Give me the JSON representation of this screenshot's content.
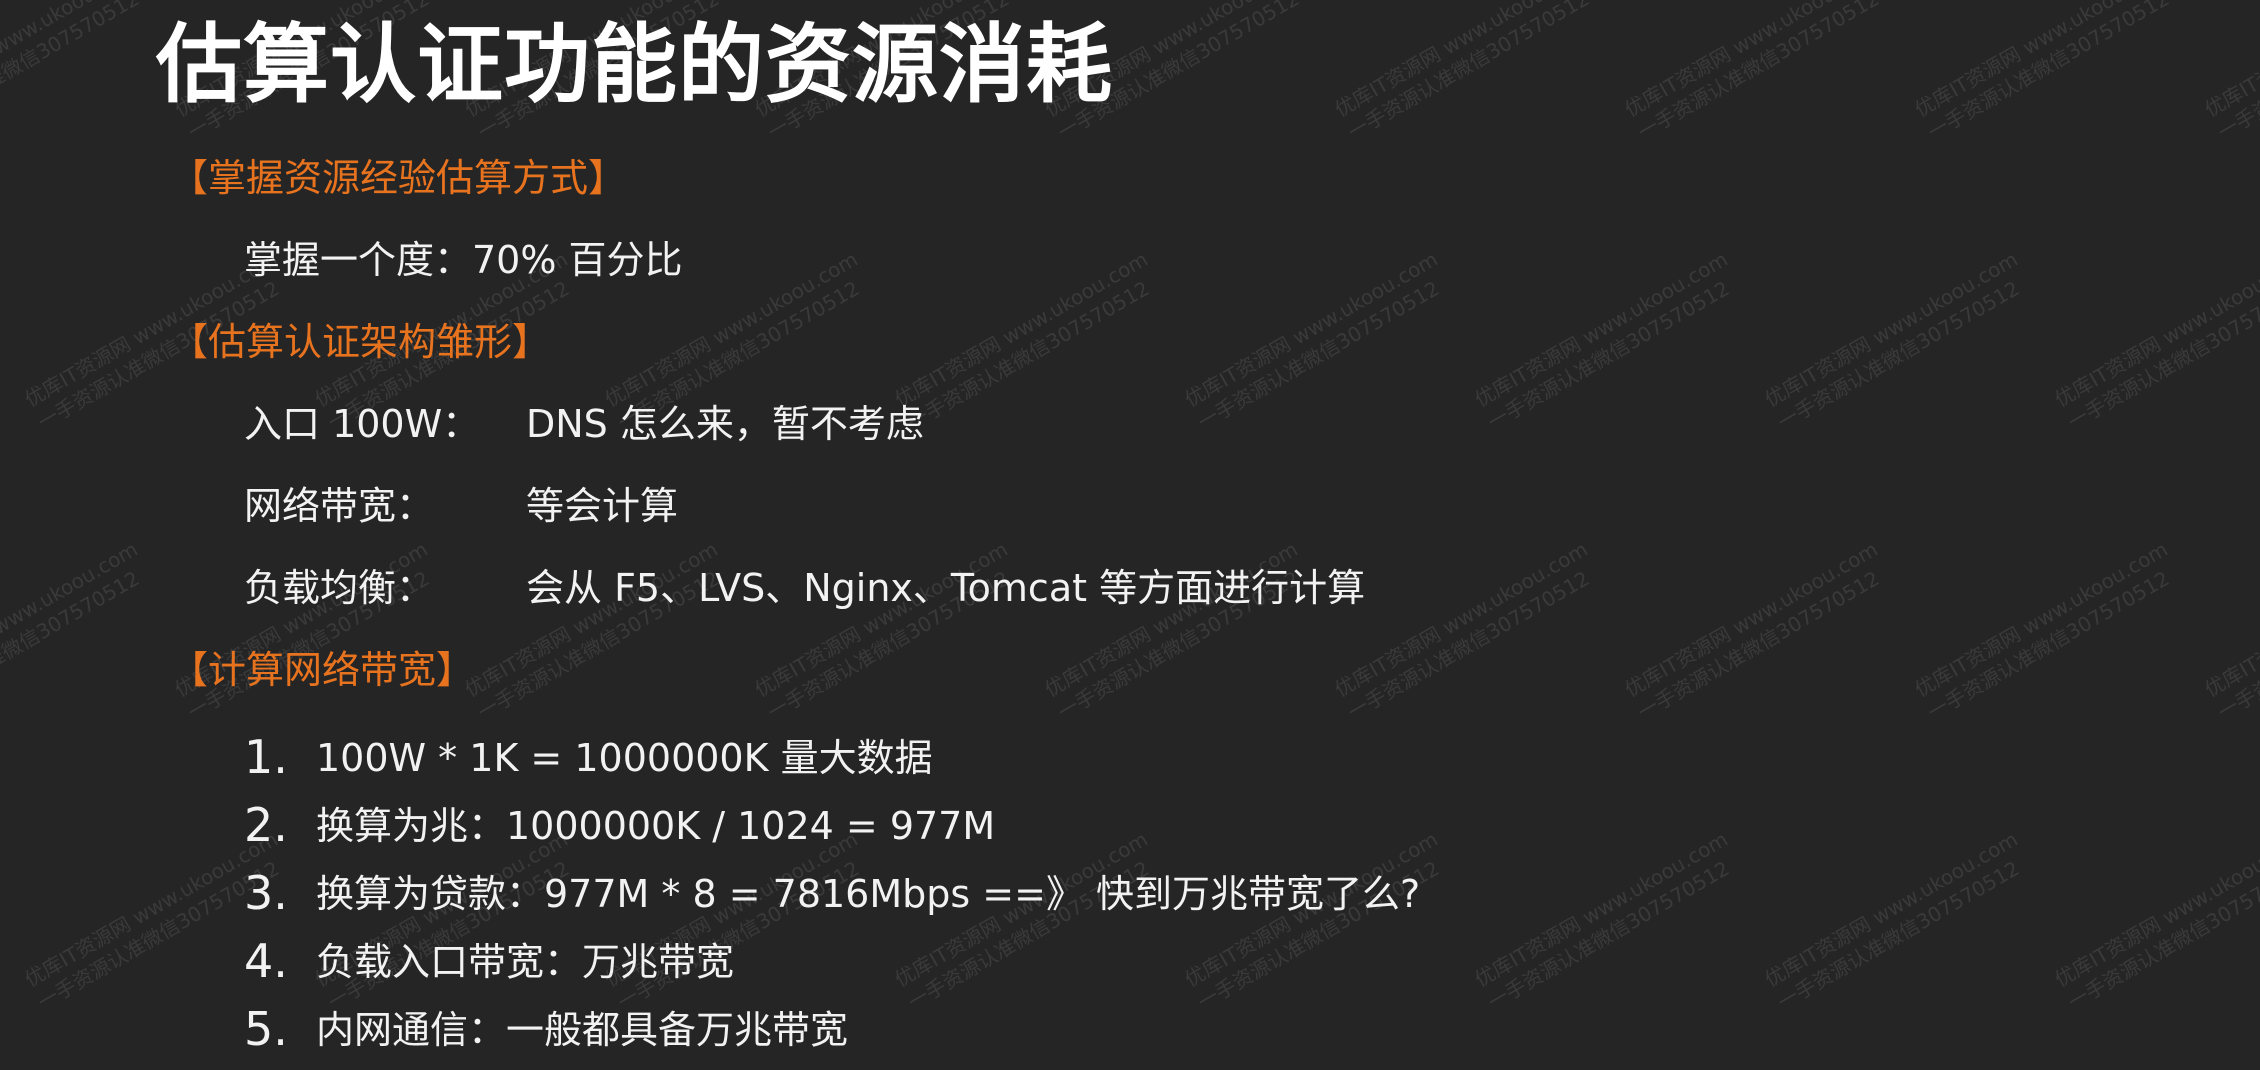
{
  "title": "估算认证功能的资源消耗",
  "sections": [
    {
      "heading": "【掌握资源经验估算方式】",
      "lines": [
        "掌握一个度：70% 百分比"
      ]
    },
    {
      "heading": "【估算认证架构雏形】",
      "rows": [
        {
          "label": "入口 100W：",
          "value": "DNS 怎么来，暂不考虑"
        },
        {
          "label": "网络带宽：",
          "value": "等会计算"
        },
        {
          "label": "负载均衡：",
          "value": "会从 F5、LVS、Nginx、Tomcat 等方面进行计算"
        }
      ]
    },
    {
      "heading": "【计算网络带宽】",
      "items": [
        {
          "num": "1.",
          "text": "100W * 1K = 1000000K 量大数据"
        },
        {
          "num": "2.",
          "text": "换算为兆：1000000K / 1024 = 977M"
        },
        {
          "num": "3.",
          "text": "换算为贷款：977M * 8 = 7816Mbps ==》 快到万兆带宽了么?"
        },
        {
          "num": "4.",
          "text": "负载入口带宽：万兆带宽"
        },
        {
          "num": "5.",
          "text": "内网通信：一般都具备万兆带宽"
        }
      ]
    }
  ],
  "watermark": {
    "line1": "优库IT资源网 www.ukoou.com",
    "line2": "一手资源认准微信307570512",
    "color": "#3a3a3a"
  },
  "colors": {
    "background": "#252525",
    "heading_accent": "#e8731f",
    "text": "#f2f2f2"
  }
}
